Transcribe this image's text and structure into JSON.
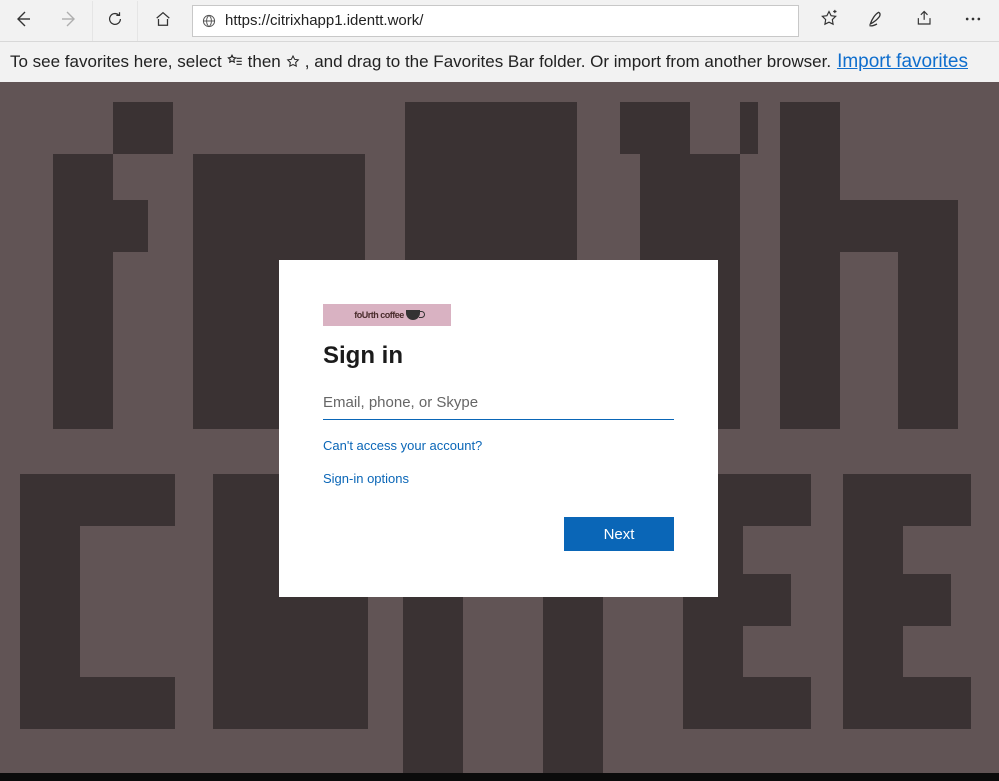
{
  "browser": {
    "url": "https://citrixhapp1.identt.work/"
  },
  "favbar": {
    "text_a": "To see favorites here, select",
    "text_b": "then",
    "text_c": ", and drag to the Favorites Bar folder. Or import from another browser.",
    "import_label": "Import favorites"
  },
  "signin": {
    "brand_text": "foUrth coffee",
    "title": "Sign in",
    "email_placeholder": "Email, phone, or Skype",
    "cant_access_label": "Can't access your account?",
    "options_label": "Sign-in options",
    "next_label": "Next"
  }
}
